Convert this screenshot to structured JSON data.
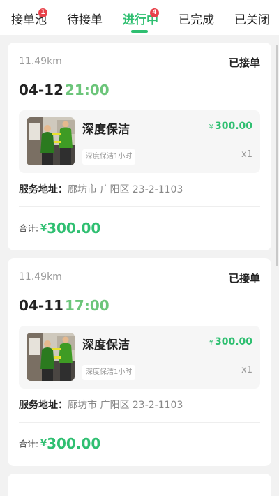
{
  "tabs": [
    {
      "label": "接单池",
      "badge": "1"
    },
    {
      "label": "待接单",
      "badge": ""
    },
    {
      "label": "进行中",
      "badge": "4"
    },
    {
      "label": "已完成",
      "badge": ""
    },
    {
      "label": "已关闭",
      "badge": ""
    }
  ],
  "active_tab": "进行中",
  "accent_color": "#2fbf71",
  "orders": [
    {
      "distance": "11.49km",
      "status": "已接单",
      "date": "04-12",
      "time": "21:00",
      "item": {
        "name": "深度保洁",
        "price_symbol": "¥",
        "price": "300.00",
        "tag": "深度保洁1小时",
        "qty": "x1"
      },
      "address_label": "服务地址：",
      "address": "廊坊市 广阳区 23-2-1103",
      "total_label": "合计:",
      "total_symbol": "¥",
      "total": "300.00"
    },
    {
      "distance": "11.49km",
      "status": "已接单",
      "date": "04-11",
      "time": "17:00",
      "item": {
        "name": "深度保洁",
        "price_symbol": "¥",
        "price": "300.00",
        "tag": "深度保洁1小时",
        "qty": "x1"
      },
      "address_label": "服务地址：",
      "address": "廊坊市 广阳区 23-2-1103",
      "total_label": "合计:",
      "total_symbol": "¥",
      "total": "300.00"
    }
  ]
}
